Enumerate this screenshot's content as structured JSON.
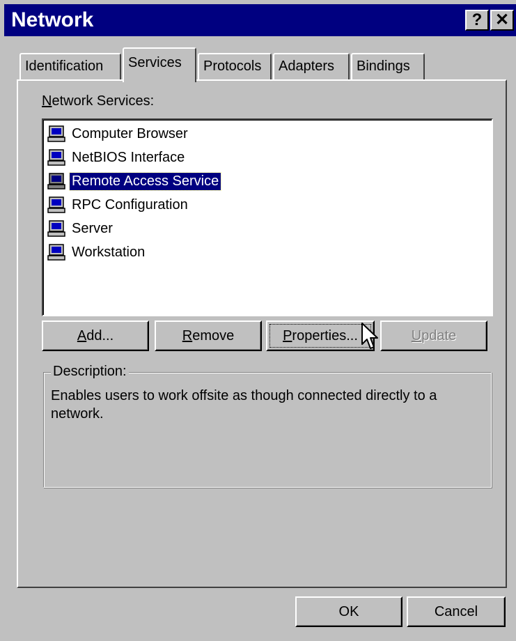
{
  "window": {
    "title": "Network",
    "help_button": "?",
    "close_button": "✕"
  },
  "tabs": [
    {
      "label": "Identification",
      "active": false
    },
    {
      "label": "Services",
      "active": true
    },
    {
      "label": "Protocols",
      "active": false
    },
    {
      "label": "Adapters",
      "active": false
    },
    {
      "label": "Bindings",
      "active": false
    }
  ],
  "services_panel": {
    "list_label_accel": "N",
    "list_label_rest": "etwork Services:",
    "items": [
      {
        "label": "Computer Browser",
        "selected": false,
        "icon": "computer-icon"
      },
      {
        "label": "NetBIOS Interface",
        "selected": false,
        "icon": "computer-icon"
      },
      {
        "label": "Remote Access Service",
        "selected": true,
        "icon": "computer-icon"
      },
      {
        "label": "RPC Configuration",
        "selected": false,
        "icon": "computer-icon"
      },
      {
        "label": "Server",
        "selected": false,
        "icon": "computer-icon"
      },
      {
        "label": "Workstation",
        "selected": false,
        "icon": "computer-icon"
      }
    ],
    "buttons": {
      "add_accel": "A",
      "add_rest": "dd...",
      "remove_accel": "R",
      "remove_rest": "emove",
      "properties_accel": "P",
      "properties_rest": "roperties...",
      "update_accel": "U",
      "update_rest": "pdate"
    },
    "description": {
      "legend": "Description:",
      "text": "Enables users to work offsite as though connected directly to a network."
    }
  },
  "footer": {
    "ok_label": "OK",
    "cancel_label": "Cancel"
  },
  "colors": {
    "titlebar": "#000080",
    "face": "#c0c0c0",
    "selection": "#000080"
  }
}
